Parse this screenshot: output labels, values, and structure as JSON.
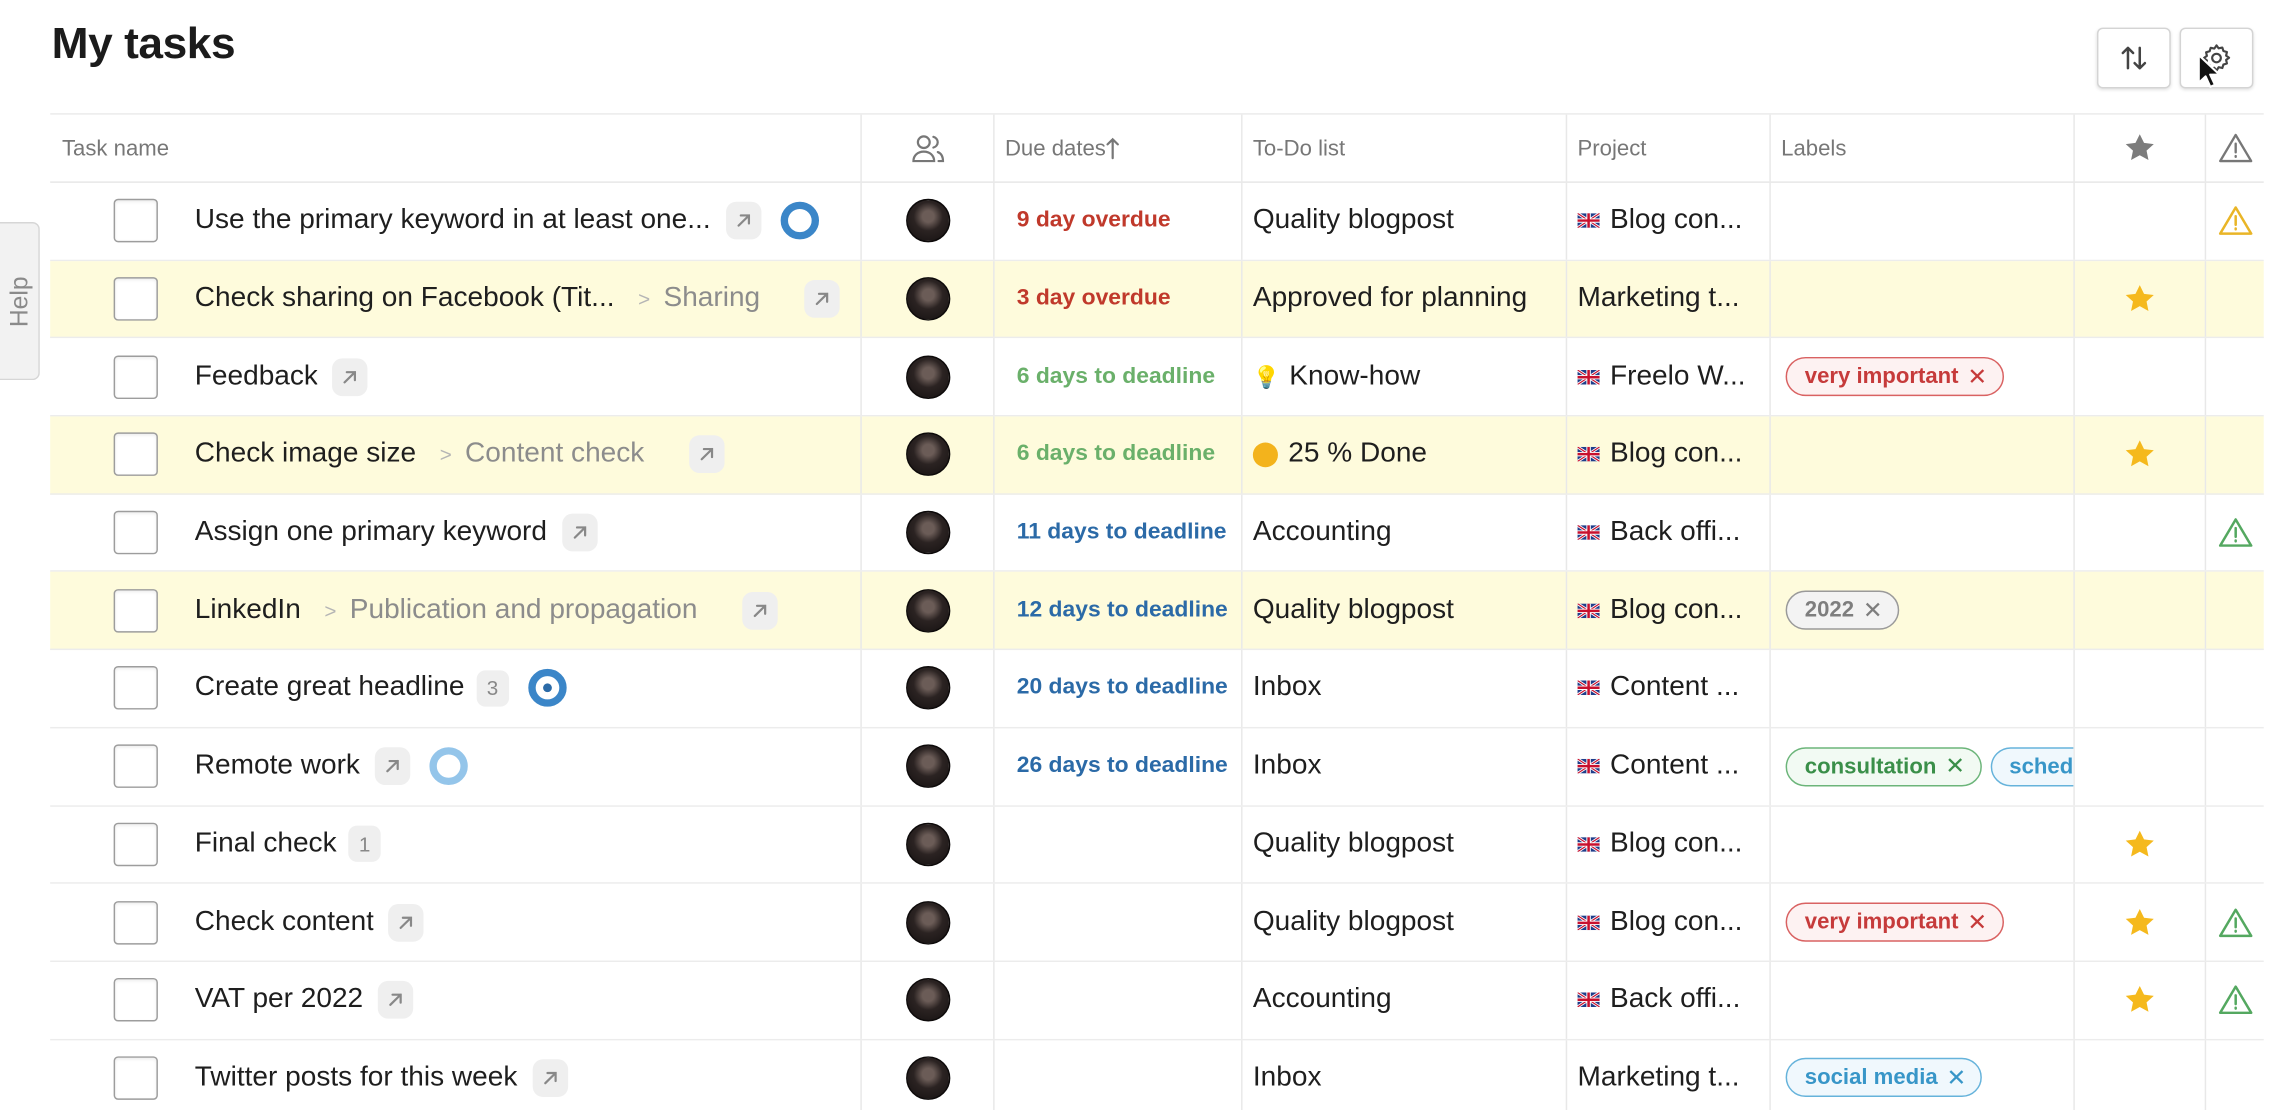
{
  "page": {
    "title": "My tasks",
    "help_label": "Help"
  },
  "toolbar": {
    "sort_icon": "sort-arrows-icon",
    "settings_icon": "gear-icon"
  },
  "columns": {
    "task_name": "Task name",
    "due": "Due dates",
    "todo": "To-Do list",
    "project": "Project",
    "labels": "Labels"
  },
  "rows": [
    {
      "name": "Use the primary keyword in at least one...",
      "parent": "",
      "link": true,
      "count": "",
      "ring": "full-blue",
      "due": "9 day overdue",
      "due_color": "red",
      "todo": "Quality blogpost",
      "todo_prefix": "",
      "project": "Blog con...",
      "flag": true,
      "labels": [],
      "star": false,
      "warn": "yellow",
      "highlight": false
    },
    {
      "name": "Check sharing on Facebook (Tit...",
      "parent": "Sharing",
      "link": true,
      "count": "",
      "ring": "",
      "due": "3 day overdue",
      "due_color": "red",
      "todo": "Approved for planning",
      "todo_prefix": "",
      "project": "Marketing t...",
      "flag": false,
      "labels": [],
      "star": true,
      "warn": "",
      "highlight": true
    },
    {
      "name": "Feedback",
      "parent": "",
      "link": true,
      "count": "",
      "ring": "",
      "due": "6 days to deadline",
      "due_color": "green",
      "todo": "Know-how",
      "todo_prefix": "bulb",
      "project": "Freelo W...",
      "flag": true,
      "labels": [
        {
          "text": "very important",
          "color": "red"
        }
      ],
      "star": false,
      "warn": "",
      "highlight": false
    },
    {
      "name": "Check image size",
      "parent": "Content check",
      "link": true,
      "count": "",
      "ring": "",
      "due": "6 days to deadline",
      "due_color": "green",
      "todo": "25 % Done",
      "todo_prefix": "dot",
      "project": "Blog con...",
      "flag": true,
      "labels": [],
      "star": true,
      "warn": "",
      "highlight": true
    },
    {
      "name": "Assign one primary keyword",
      "parent": "",
      "link": true,
      "count": "",
      "ring": "",
      "due": "11 days to deadline",
      "due_color": "blue",
      "todo": "Accounting",
      "todo_prefix": "",
      "project": "Back offi...",
      "flag": true,
      "labels": [],
      "star": false,
      "warn": "green",
      "highlight": false
    },
    {
      "name": "LinkedIn",
      "parent": "Publication and propagation",
      "link": true,
      "count": "",
      "ring": "",
      "due": "12 days to deadline",
      "due_color": "blue",
      "todo": "Quality blogpost",
      "todo_prefix": "",
      "project": "Blog con...",
      "flag": true,
      "labels": [
        {
          "text": "2022",
          "color": "gray"
        }
      ],
      "star": false,
      "warn": "",
      "highlight": true
    },
    {
      "name": "Create great headline",
      "parent": "",
      "link": false,
      "count": "3",
      "ring": "dot-blue",
      "due": "20 days to deadline",
      "due_color": "blue",
      "todo": "Inbox",
      "todo_prefix": "",
      "project": "Content ...",
      "flag": true,
      "labels": [],
      "star": false,
      "warn": "",
      "highlight": false
    },
    {
      "name": "Remote work",
      "parent": "",
      "link": true,
      "count": "",
      "ring": "light-blue",
      "due": "26 days to deadline",
      "due_color": "blue",
      "todo": "Inbox",
      "todo_prefix": "",
      "project": "Content ...",
      "flag": true,
      "labels": [
        {
          "text": "consultation",
          "color": "green"
        },
        {
          "text": "sched",
          "color": "blue"
        }
      ],
      "star": false,
      "warn": "",
      "highlight": false
    },
    {
      "name": "Final check",
      "parent": "",
      "link": false,
      "count": "1",
      "ring": "",
      "due": "",
      "due_color": "blue",
      "todo": "Quality blogpost",
      "todo_prefix": "",
      "project": "Blog con...",
      "flag": true,
      "labels": [],
      "star": true,
      "warn": "",
      "highlight": false
    },
    {
      "name": "Check content",
      "parent": "",
      "link": true,
      "count": "",
      "ring": "",
      "due": "",
      "due_color": "blue",
      "todo": "Quality blogpost",
      "todo_prefix": "",
      "project": "Blog con...",
      "flag": true,
      "labels": [
        {
          "text": "very important",
          "color": "red"
        }
      ],
      "star": true,
      "warn": "green",
      "highlight": false
    },
    {
      "name": "VAT per 2022",
      "parent": "",
      "link": true,
      "count": "",
      "ring": "",
      "due": "",
      "due_color": "blue",
      "todo": "Accounting",
      "todo_prefix": "",
      "project": "Back offi...",
      "flag": true,
      "labels": [],
      "star": true,
      "warn": "green",
      "highlight": false
    },
    {
      "name": "Twitter posts for this week",
      "parent": "",
      "link": true,
      "count": "",
      "ring": "",
      "due": "",
      "due_color": "blue",
      "todo": "Inbox",
      "todo_prefix": "",
      "project": "Marketing t...",
      "flag": false,
      "labels": [
        {
          "text": "social media",
          "color": "blue"
        }
      ],
      "star": false,
      "warn": "",
      "highlight": false
    }
  ]
}
